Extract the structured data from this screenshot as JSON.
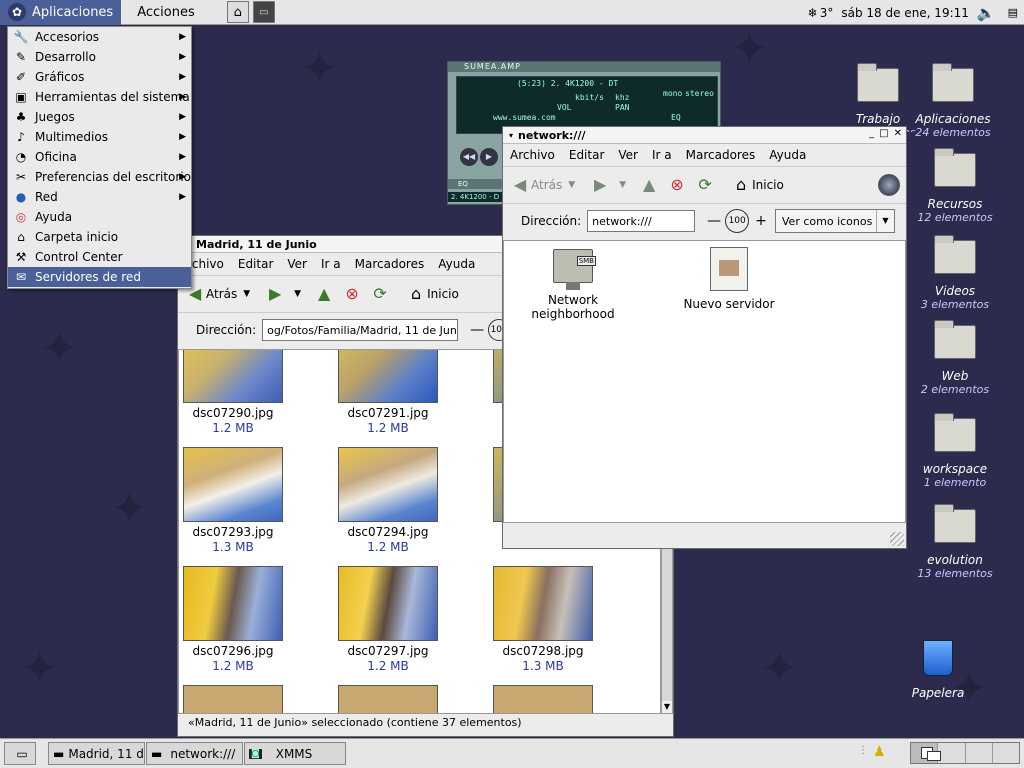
{
  "top_panel": {
    "applications_label": "Aplicaciones",
    "actions_label": "Acciones",
    "weather": "3°",
    "clock": "sáb 18 de ene, 19:11"
  },
  "app_menu": {
    "items": [
      {
        "label": "Accesorios",
        "icon": "accessories-icon",
        "submenu": true
      },
      {
        "label": "Desarrollo",
        "icon": "development-icon",
        "submenu": true
      },
      {
        "label": "Gráficos",
        "icon": "graphics-icon",
        "submenu": true
      },
      {
        "label": "Herramientas del sistema",
        "icon": "system-tools-icon",
        "submenu": true
      },
      {
        "label": "Juegos",
        "icon": "games-icon",
        "submenu": true
      },
      {
        "label": "Multimedios",
        "icon": "multimedia-icon",
        "submenu": true
      },
      {
        "label": "Oficina",
        "icon": "office-icon",
        "submenu": true
      },
      {
        "label": "Preferencias del escritorio",
        "icon": "preferences-icon",
        "submenu": true
      },
      {
        "label": "Red",
        "icon": "network-icon",
        "submenu": true
      },
      {
        "label": "Ayuda",
        "icon": "help-icon",
        "submenu": false
      },
      {
        "label": "Carpeta inicio",
        "icon": "home-folder-icon",
        "submenu": false
      },
      {
        "label": "Control Center",
        "icon": "control-center-icon",
        "submenu": false
      },
      {
        "label": "Servidores de red",
        "icon": "network-servers-icon",
        "submenu": false,
        "selected": true
      }
    ]
  },
  "xmms": {
    "title": "SUMEA.AMP",
    "track": "(5:23)    2. 4K1200 - DT",
    "kbps_label": "kbit/s",
    "khz_label": "khz",
    "mono_label": "mono",
    "stereo_label": "stereo",
    "url": "www.sumea.com",
    "eq_label": "EQ",
    "vol_label": "VOL",
    "pan_label": "PAN",
    "eq_bottom": "2. 4K1200 - D"
  },
  "madrid_window": {
    "title": "Madrid, 11 de Junio",
    "menu": [
      "Archivo",
      "Editar",
      "Ver",
      "Ir a",
      "Marcadores",
      "Ayuda"
    ],
    "back_label": "Atrás",
    "home_label": "Inicio",
    "location_label": "Dirección:",
    "location_value": "og/Fotos/Familia/Madrid, 11 de Junio",
    "zoom_value": "100",
    "files": [
      {
        "name": "dsc07290.jpg",
        "size": "1.2 MB"
      },
      {
        "name": "dsc07291.jpg",
        "size": "1.2 MB"
      },
      {
        "name": "dsc07293.jpg",
        "size": "1.3 MB"
      },
      {
        "name": "dsc07294.jpg",
        "size": "1.2 MB"
      },
      {
        "name": "dsc07296.jpg",
        "size": "1.2 MB"
      },
      {
        "name": "dsc07297.jpg",
        "size": "1.2 MB"
      },
      {
        "name": "dsc07298.jpg",
        "size": "1.3 MB"
      }
    ],
    "status": "«Madrid, 11 de Junio» seleccionado (contiene 37 elementos)"
  },
  "network_window": {
    "title": "network:///",
    "menu": [
      "Archivo",
      "Editar",
      "Ver",
      "Ir a",
      "Marcadores",
      "Ayuda"
    ],
    "back_label": "Atrás",
    "home_label": "Inicio",
    "location_label": "Dirección:",
    "location_value": "network:///",
    "zoom_value": "100",
    "view_as": "Ver como iconos",
    "items": [
      {
        "label": "Network neighborhood",
        "badge": "SMB"
      },
      {
        "label": "Nuevo servidor"
      }
    ]
  },
  "desktop_icons": [
    {
      "name": "Trabajo",
      "sub": "12 elementos"
    },
    {
      "name": "Aplicaciones",
      "sub": "24 elementos"
    },
    {
      "name": "Recursos",
      "sub": "12 elementos"
    },
    {
      "name": "Videos",
      "sub": "3 elementos"
    },
    {
      "name": "Web",
      "sub": "2 elementos"
    },
    {
      "name": "workspace",
      "sub": "1 elemento"
    },
    {
      "name": "evolution",
      "sub": "13 elementos"
    },
    {
      "name": "Papelera",
      "sub": ""
    }
  ],
  "taskbar": {
    "tasks": [
      "Madrid, 11 de J",
      "network:///",
      "XMMS"
    ]
  }
}
